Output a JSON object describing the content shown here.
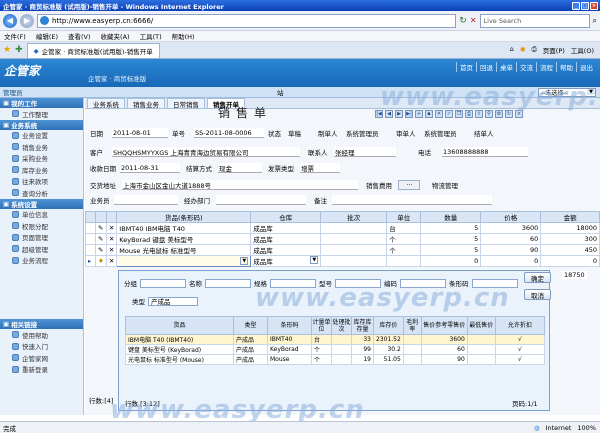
{
  "window": {
    "title": "企管家 · 商贸标准版 (试用版)-销售开单 - Windows Internet Explorer"
  },
  "browser": {
    "url": "http://www.easyerp.cn:6666/",
    "search_placeholder": "Live Search",
    "menu": [
      "文件(F)",
      "编辑(E)",
      "查看(V)",
      "收藏夹(A)",
      "工具(T)",
      "帮助(H)"
    ],
    "tab": "企管家 · 商贸标准版(试用版)-销售开单",
    "tab_tools": [
      "页面(P)",
      "工具(O)"
    ],
    "status": "完成",
    "status_zone": "Internet",
    "zoom": "100%"
  },
  "app": {
    "logo": "企管家",
    "edition": "企管家 · 商贸标准版",
    "topnav": [
      "首页",
      "回退",
      "桌单",
      "交流",
      "流程",
      "帮助",
      "退出"
    ],
    "user": "管理员",
    "company_select": "--未选择--",
    "company_label": "站"
  },
  "sidebar": [
    {
      "head": "我的工作",
      "items": [
        "工作整理"
      ]
    },
    {
      "head": "业务系统",
      "items": [
        "业务设置",
        "销售业务",
        "采购业务",
        "库存业务",
        "往来款项",
        "查询分析"
      ]
    },
    {
      "head": "系统设置",
      "items": [
        "单位信息",
        "权限分配",
        "页面管理",
        "超级管理",
        "业务流程"
      ]
    },
    {
      "head": "相关链接",
      "items": [
        "使用帮助",
        "快速入门",
        "企管家网",
        "重新登录"
      ]
    }
  ],
  "breadcrumb": [
    "业务系统",
    "销售业务",
    "日常销售",
    "销售开单"
  ],
  "doc": {
    "title": "销售单",
    "date_label": "日期",
    "date": "2011-08-01",
    "no_label": "单号",
    "no": "SS-2011-08-0006",
    "state_label": "状态",
    "state": "草稿",
    "maker_label": "制单人",
    "maker": "系统管理员",
    "auditor_label": "审单人",
    "auditor": "系统管理员",
    "closer_label": "结单人",
    "customer_label": "客户",
    "customer": "SHQQHSMYYXGS 上海青青海边贸易有限公司",
    "contact_label": "联系人",
    "contact": "张经理",
    "phone_label": "电话",
    "phone": "13608888888",
    "pay_date_label": "收款日期",
    "pay_date": "2011-08-31",
    "settle_label": "结算方式",
    "settle": "现金",
    "invoice_label": "发票类型",
    "invoice": "增票",
    "address_label": "交货地址",
    "address": "上海市金山区金山大道1888号",
    "fee_label": "销售费用",
    "fee_btn": "···",
    "logistics_label": "物流管理",
    "salesman_label": "业务员",
    "dept_label": "经办部门",
    "remark_label": "备注"
  },
  "grid": {
    "columns": [
      "货品(条形码)",
      "仓库",
      "批次",
      "单位",
      "数量",
      "价格",
      "金额"
    ],
    "rows": [
      {
        "goods": "IBMT40 IBM电脑 T40",
        "wh": "成品库",
        "batch": "",
        "unit": "台",
        "qty": "5",
        "price": "3600",
        "amount": "18000"
      },
      {
        "goods": "KeyBorad 键盘 美标型号",
        "wh": "成品库",
        "batch": "",
        "unit": "个",
        "qty": "5",
        "price": "60",
        "amount": "300"
      },
      {
        "goods": "Mouse 光电鼠标 标准型号",
        "wh": "成品库",
        "batch": "",
        "unit": "个",
        "qty": "5",
        "price": "90",
        "amount": "450"
      }
    ],
    "new_row": {
      "wh": "成品库",
      "qty": "0",
      "price": "0",
      "amount": "0"
    },
    "total": "18750",
    "footer": "行数:[4]"
  },
  "popup": {
    "filters": [
      "分组",
      "名称",
      "规格",
      "型号",
      "编码",
      "条形码"
    ],
    "type_label": "类型",
    "type_value": "产成品",
    "ok": "确定",
    "cancel": "取消",
    "columns": [
      "货品",
      "类型",
      "条形码",
      "计量单位",
      "处理批次",
      "库存库存量",
      "库存价",
      "毛利率",
      "售价参考零售价",
      "最低售价",
      "允许折扣"
    ],
    "rows": [
      {
        "goods": "IBM电脑 T40 (IBMT40)",
        "type": "产成品",
        "code": "IBMT40",
        "unit": "台",
        "batch": "",
        "stock": "33",
        "cost": "2301.52",
        "margin": "",
        "price": "3600",
        "min": "",
        "disc": "√"
      },
      {
        "goods": "键盘 美标型号 (KeyBorad)",
        "type": "产成品",
        "code": "KeyBorad",
        "unit": "个",
        "batch": "",
        "stock": "99",
        "cost": "30.2",
        "margin": "",
        "price": "60",
        "min": "",
        "disc": "√"
      },
      {
        "goods": "光电鼠标 标准型号 (Mouse)",
        "type": "产成品",
        "code": "Mouse",
        "unit": "个",
        "batch": "",
        "stock": "19",
        "cost": "51.05",
        "margin": "",
        "price": "90",
        "min": "",
        "disc": "√"
      }
    ],
    "footer_rows": "行数 [3:12]",
    "footer_page": "页码:1/1"
  },
  "watermark": "www.easyerp.cn"
}
